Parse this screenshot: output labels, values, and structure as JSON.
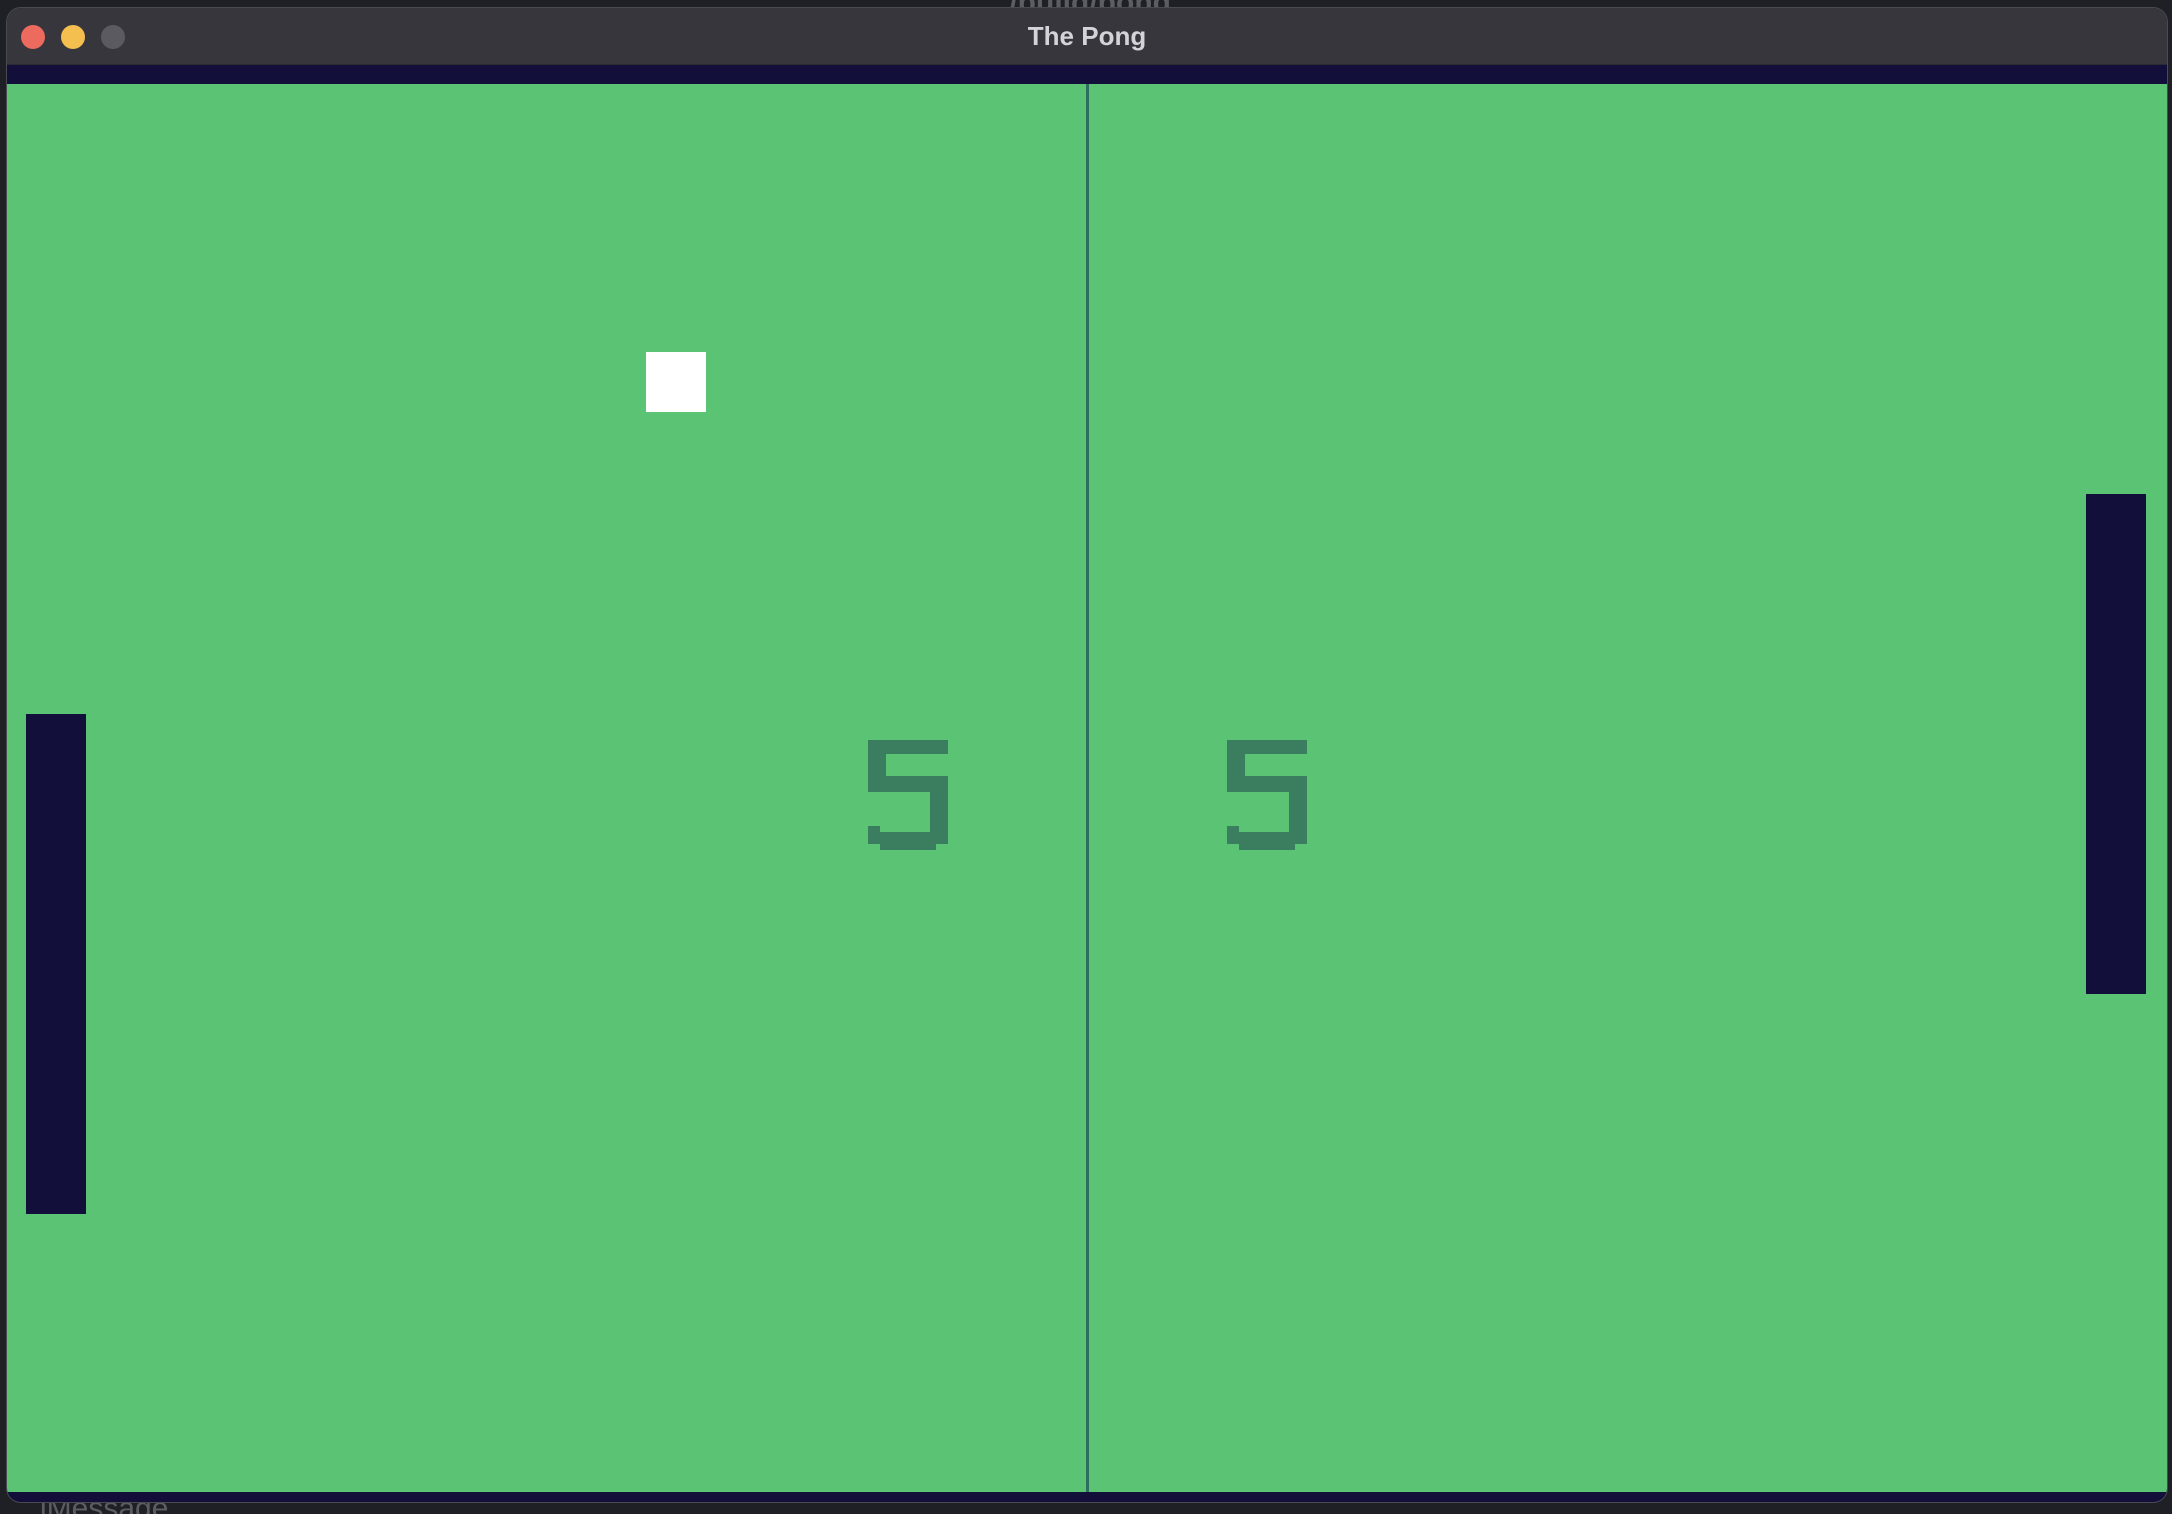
{
  "window": {
    "title": "The Pong",
    "background_title": "./build/pong",
    "background_bottom_text": "iMessage"
  },
  "game": {
    "scores": {
      "left": "5",
      "right": "5"
    },
    "colors": {
      "field": "#5ac374",
      "paddle": "#12103b",
      "ball": "#ffffff",
      "net": "#2f6e5c",
      "score": "#3a7d5f"
    }
  }
}
